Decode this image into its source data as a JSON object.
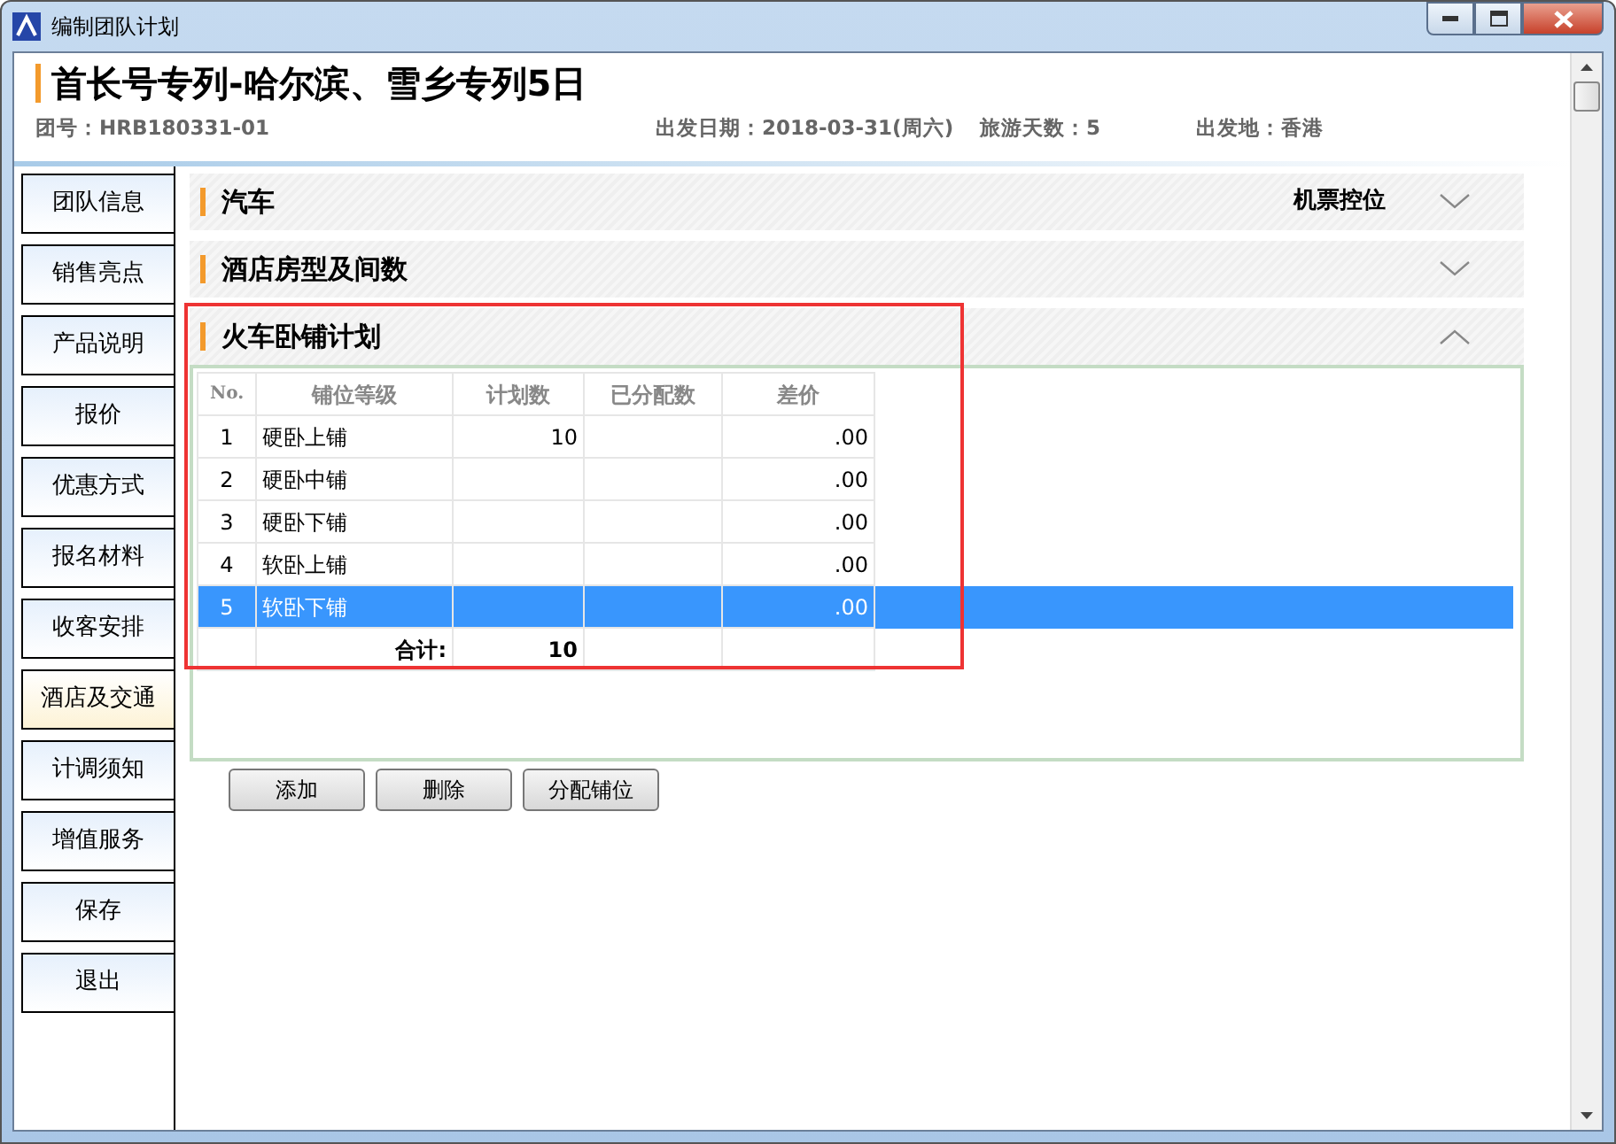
{
  "window": {
    "title": "编制团队计划"
  },
  "header": {
    "title": "首长号专列-哈尔滨、雪乡专列5日",
    "group_no": "团号：HRB180331-01",
    "departure_date": "出发日期：2018-03-31(周六)",
    "days": "旅游天数：5",
    "origin": "出发地：香港"
  },
  "sidebar": {
    "items": [
      {
        "label": "团队信息",
        "selected": false
      },
      {
        "label": "销售亮点",
        "selected": false
      },
      {
        "label": "产品说明",
        "selected": false
      },
      {
        "label": "报价",
        "selected": false
      },
      {
        "label": "优惠方式",
        "selected": false
      },
      {
        "label": "报名材料",
        "selected": false
      },
      {
        "label": "收客安排",
        "selected": false
      },
      {
        "label": "酒店及交通",
        "selected": true
      },
      {
        "label": "计调须知",
        "selected": false
      },
      {
        "label": "增值服务",
        "selected": false
      },
      {
        "label": "保存",
        "selected": false
      },
      {
        "label": "退出",
        "selected": false
      }
    ]
  },
  "sections": [
    {
      "title": "汽车",
      "extra": "机票控位",
      "expanded": false,
      "highlighted": false
    },
    {
      "title": "酒店房型及间数",
      "expanded": false,
      "highlighted": false
    },
    {
      "title": "火车卧铺计划",
      "expanded": true,
      "highlighted": true,
      "table": {
        "columns": [
          "No.",
          "铺位等级",
          "计划数",
          "已分配数",
          "差价"
        ],
        "rows": [
          {
            "no": "1",
            "grade": "硬卧上铺",
            "planned": "10",
            "diff": ".00",
            "selected": false
          },
          {
            "no": "2",
            "grade": "硬卧中铺",
            "diff": ".00",
            "selected": false
          },
          {
            "no": "3",
            "grade": "硬卧下铺",
            "diff": ".00",
            "selected": false
          },
          {
            "no": "4",
            "grade": "软卧上铺",
            "diff": ".00",
            "selected": false
          },
          {
            "no": "5",
            "grade": "软卧下铺",
            "diff": ".00",
            "selected": true
          }
        ],
        "total": {
          "label": "合计:",
          "planned": "10"
        }
      },
      "buttons": [
        "添加",
        "删除",
        "分配铺位"
      ]
    }
  ]
}
